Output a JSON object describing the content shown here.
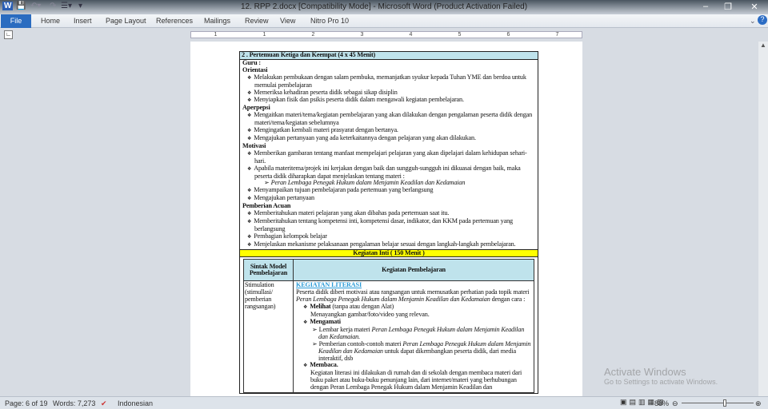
{
  "window": {
    "title": "12. RPP 2.docx [Compatibility Mode] - Microsoft Word (Product Activation Failed)"
  },
  "ribbon": {
    "tabs": [
      "File",
      "Home",
      "Insert",
      "Page Layout",
      "References",
      "Mailings",
      "Review",
      "View",
      "Nitro Pro 10"
    ]
  },
  "ruler": {
    "marks": [
      "1",
      "1",
      "2",
      "3",
      "4",
      "5",
      "6",
      "7"
    ]
  },
  "doc": {
    "header": "2 . Pertemuan Ketiga dan Keempat (4 x 45 Menit)",
    "guru": "Guru :",
    "orientasi": {
      "title": "Orientasi",
      "items": [
        "Melakukan pembukaan dengan salam pembuka, memanjatkan syukur kepada Tuhan YME dan berdoa untuk memulai pembelajaran",
        "Memeriksa kehadiran peserta didik sebagai sikap disiplin",
        "Menyiapkan fisik dan psikis peserta didik dalam mengawali kegiatan pembelajaran."
      ]
    },
    "apersepsi": {
      "title": "Aperpepsi",
      "items": [
        "Mengaitkan materi/tema/kegiatan pembelajaran yang akan dilakukan dengan pengalaman peserta didik dengan materi/tema/kegiatan sebelumnya",
        "Mengingatkan kembali materi prasyarat dengan bertanya.",
        "Mengajukan pertanyaan yang ada keterkaitannya dengan pelajaran yang akan dilakukan."
      ]
    },
    "motivasi": {
      "title": "Motivasi",
      "items": [
        "Memberikan gambaran tentang manfaat mempelajari pelajaran yang akan dipelajari dalam kehidupan sehari-hari.",
        "Apabila materitema/projek ini kerjakan dengan baik dan sungguh-sungguh ini dikuasai dengan baik, maka peserta didik diharapkan dapat menjelaskan tentang materi :",
        "Menyampaikan tujuan pembelajaran pada pertemuan yang berlangsung",
        "Mengajukan pertanyaan"
      ],
      "sub": "Peran Lembaga Penegak Hukum dalam Menjamin Keadilan dan Kedamaian"
    },
    "acuan": {
      "title": "Pemberian Acuan",
      "items": [
        "Memberitahukan materi pelajaran yang akan dibahas pada pertemuan saat itu.",
        "Memberitahukan tentang kompetensi inti, kompetensi dasar, indikator, dan KKM pada pertemuan yang berlangsung",
        "Pembagian kelompok belajar",
        "Menjelaskan mekanisme pelaksanaan pengalaman belajar sesuai dengan langkah-langkah pembelajaran."
      ]
    },
    "inti": "Kegiatan Inti ( 150 Menit )",
    "table": {
      "col1": "Sintak Model Pembelajaran",
      "col2": "Kegiatan Pembelajaran",
      "row_label": "Stimulation (stimullasi/ pemberian rangsangan)",
      "literasi": "KEGIATAN LITERASI",
      "intro": "Peserta didik diberi motivasi atau rangsangan untuk memusatkan perhatian pada topik materi",
      "topic": "Peran Lembaga Penegak Hukum dalam Menjamin Keadilan dan Kedamaian",
      "intro_end": "dengan cara :",
      "melihat": "Melihat",
      "melihat_note": "(tanpa atau dengan Alat)",
      "melihat_text": "Menayangkan gambar/foto/video yang relevan.",
      "mengamati": "Mengamati",
      "m1": "Lembar kerja materi",
      "m1_topic": "Peran Lembaga Penegak Hukum dalam Menjamin Keadilan dan Kedamaian.",
      "m2": "Pemberian contoh-contoh materi",
      "m2_end": "untuk dapat dikembangkan peserta didik, dari media interaktif, dsb",
      "membaca": "Membaca.",
      "membaca_text": "Kegiatan literasi ini dilakukan di rumah dan di sekolah dengan membaca materi dari buku paket atau buku-buku penunjang lain, dari internet/materi yang berhubungan dengan Peran Lembaga Penegak Hukum dalam Menjamin Keadilan dan"
    }
  },
  "status": {
    "page": "Page: 6 of 19",
    "words": "Words: 7,273",
    "language": "Indonesian",
    "zoom": "88%"
  },
  "watermark": {
    "title": "Activate Windows",
    "sub": "Go to Settings to activate Windows."
  }
}
